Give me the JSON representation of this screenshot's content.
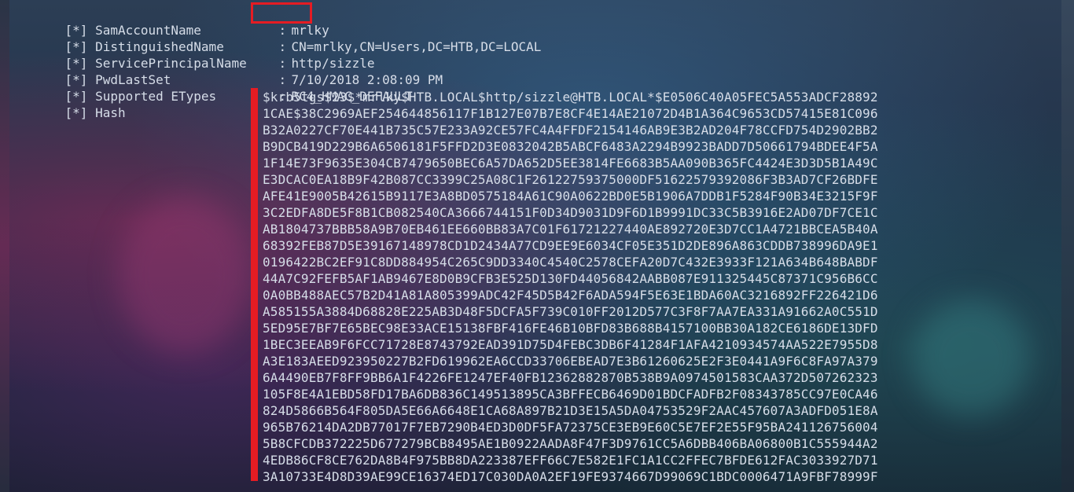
{
  "theme": {
    "text_color": "#d6dde8",
    "highlight_color": "#e51c23"
  },
  "fields": [
    {
      "label": "[*] SamAccountName",
      "value": "mrlky"
    },
    {
      "label": "[*] DistinguishedName",
      "value": "CN=mrlky,CN=Users,DC=HTB,DC=LOCAL"
    },
    {
      "label": "[*] ServicePrincipalName",
      "value": "http/sizzle"
    },
    {
      "label": "[*] PwdLastSet",
      "value": "7/10/2018 2:08:09 PM"
    },
    {
      "label": "[*] Supported ETypes",
      "value": "RC4_HMAC_DEFAULT"
    },
    {
      "label": "[*] Hash",
      "value": ""
    }
  ],
  "hash_lines": [
    "$krb5tgs$23$*mrlky$HTB.LOCAL$http/sizzle@HTB.LOCAL*$E0506C40A05FEC5A553ADCF28892",
    "1CAE$38C2969AEF254644856117F1B127E07B7E8CF4E14AE21072D4B1A364C9653CD57415E81C096",
    "B32A0227CF70E441B735C57E233A92CE57FC4A4FFDF2154146AB9E3B2AD204F78CCFD754D2902BB2",
    "B9DCB419D229B6A6506181F5FFD2D3E0832042B5ABCF6483A2294B9923BADD7D50661794BDEE4F5A",
    "1F14E73F9635E304CB7479650BEC6A57DA652D5EE3814FE6683B5AA090B365FC4424E3D3D5B1A49C",
    "E3DCAC0EA18B9F42B087CC3399C25A08C1F26122759375000DF51622579392086F3B3AD7CF26BDFE",
    "AFE41E9005B42615B9117E3A8BD0575184A61C90A0622BD0E5B1906A7DDB1F5284F90B34E3215F9F",
    "3C2EDFA8DE5F8B1CB082540CA3666744151F0D34D9031D9F6D1B9991DC33C5B3916E2AD07DF7CE1C",
    "AB1804737BBB58A9B70EB461EE660BB83A7C01F61721227440AE892720E3D7CC1A4721BBCEA5B40A",
    "68392FEB87D5E39167148978CD1D2434A77CD9EE9E6034CF05E351D2DE896A863CDDB738996DA9E1",
    "0196422BC2EF91C8DD884954C265C9DD3340C4540C2578CEFA20D7C432E3933F121A634B648BABDF",
    "44A7C92FEFB5AF1AB9467E8D0B9CFB3E525D130FD44056842AABB087E911325445C87371C956B6CC",
    "0A0BB488AEC57B2D41A81A805399ADC42F45D5B42F6ADA594F5E63E1BDA60AC3216892FF226421D6",
    "A585155A3884D68828E225AB3D48F5DCFA5F739C010FF2012D577C3F8F7AA7EA331A91662A0C551D",
    "5ED95E7BF7E65BEC98E33ACE15138FBF416FE46B10BFD83B688B4157100BB30A182CE6186DE13DFD",
    "1BEC3EEAB9F6FCC71728E8743792EAD391D75D4FEBC3DB6F41284F1AFA4210934574AA522E7955D8",
    "A3E183AEED923950227B2FD619962EA6CCD33706EBEAD7E3B61260625E2F3E0441A9F6C8FA97A379",
    "6A4490EB7F8FF9BB6A1F4226FE1247EF40FB12362882870B538B9A0974501583CAA372D507262323",
    "105F8E4A1EBD58FD17BA6DB836C149513895CA3BFFECB6469D01BDCFADFB2F08343785CC97E0CA46",
    "824D5866B564F805DA5E66A6648E1CA68A897B21D3E15A5DA04753529F2AAC457607A3ADFD051E8A",
    "965B76214DA2DB77017F7EB7290B4ED3D0DF5FA72375CE3EB9E60C5E7EF2E55F95BA241126756004",
    "5B8CFCDB372225D677279BCB8495AE1B0922AADA8F47F3D9761CC5A6DBB406BA06800B1C555944A2",
    "4EDB86CF8CE762DA8B4F975BB8DA223387EFF66C7E582E1FC1A1CC2FFEC7BFDE612FAC3033927D71",
    "3A10733E4D8D39AE99CE16374ED17C030DA0A2EF19FE9374667D99069C1BDC0006471A9FBF78999F"
  ]
}
